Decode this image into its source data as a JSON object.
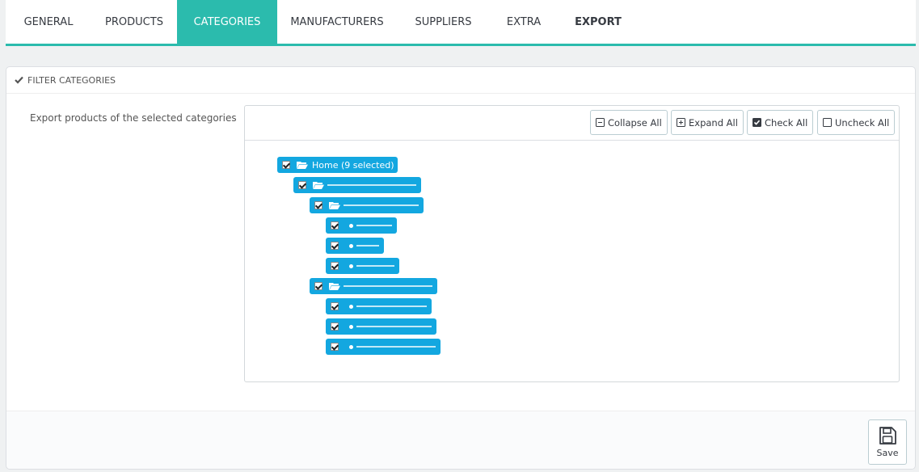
{
  "tabs": [
    {
      "label": "GENERAL"
    },
    {
      "label": "PRODUCTS"
    },
    {
      "label": "CATEGORIES"
    },
    {
      "label": "MANUFACTURERS"
    },
    {
      "label": "SUPPLIERS"
    },
    {
      "label": "EXTRA"
    },
    {
      "label": "EXPORT"
    }
  ],
  "panel": {
    "heading": "FILTER CATEGORIES",
    "field_label": "Export products of the selected categories",
    "toolbar": {
      "collapse_all": "Collapse All",
      "expand_all": "Expand All",
      "check_all": "Check All",
      "uncheck_all": "Uncheck All"
    },
    "tree": {
      "root_label": "Home (9 selected)"
    },
    "save_label": "Save"
  },
  "colors": {
    "tab_accent": "#2bbbad",
    "tree_node": "#13a7e0"
  }
}
